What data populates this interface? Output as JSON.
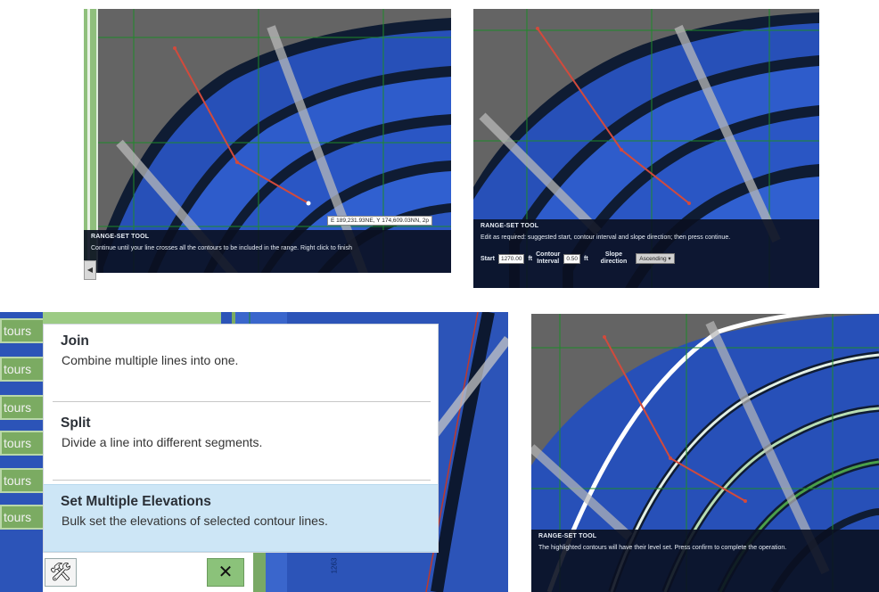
{
  "colors": {
    "contour_fill": "#2c58c4",
    "contour_dark": "#0f1c33",
    "contour_highlight_white": "#ffffff",
    "contour_highlight_green": "#4ba04a",
    "range_line": "#d24a3c",
    "grid_line": "#1e8a2a",
    "background_gray": "#646464",
    "app_green": "#7bab62",
    "menu_selected": "#cde6f6"
  },
  "panel_tl": {
    "tool_title": "RANGE-SET TOOL",
    "tool_message": "Continue until your line crosses all the contours to be included in the range. Right click to finish",
    "coord_readout": "E 189,231.93NE, Y 174,609.03NN, 2p",
    "scroll_left_icon": "chevron-left-icon"
  },
  "panel_tr": {
    "tool_title": "RANGE-SET TOOL",
    "tool_message": "Edit as required: suggested start, contour interval and slope direction; then press continue.",
    "start_label": "Start",
    "start_value": "1270.00",
    "start_unit": "ft",
    "interval_label_1": "Contour",
    "interval_label_2": "Interval",
    "interval_value": "0.50",
    "interval_unit": "ft",
    "slope_label_1": "Slope",
    "slope_label_2": "direction",
    "slope_value": "Ascending ▾"
  },
  "panel_bl": {
    "side_tabs": [
      "tours",
      "tours",
      "tours",
      "tours",
      "tours",
      "tours"
    ],
    "menu_items": [
      {
        "title": "Join",
        "desc": "Combine multiple lines into one."
      },
      {
        "title": "Split",
        "desc": "Divide a line into different segments."
      },
      {
        "title": "Set Multiple Elevations",
        "desc": "Bulk set the elevations of selected contour lines."
      }
    ],
    "selected_index": 2,
    "tools_icon": "tools-icon",
    "tools_glyph": "🛠",
    "close_icon": "close-icon",
    "close_glyph": "✕",
    "vertical_label": "1263"
  },
  "panel_br": {
    "tool_title": "RANGE-SET TOOL",
    "tool_message": "The highlighted contours will have their level set. Press confirm to complete the operation."
  }
}
